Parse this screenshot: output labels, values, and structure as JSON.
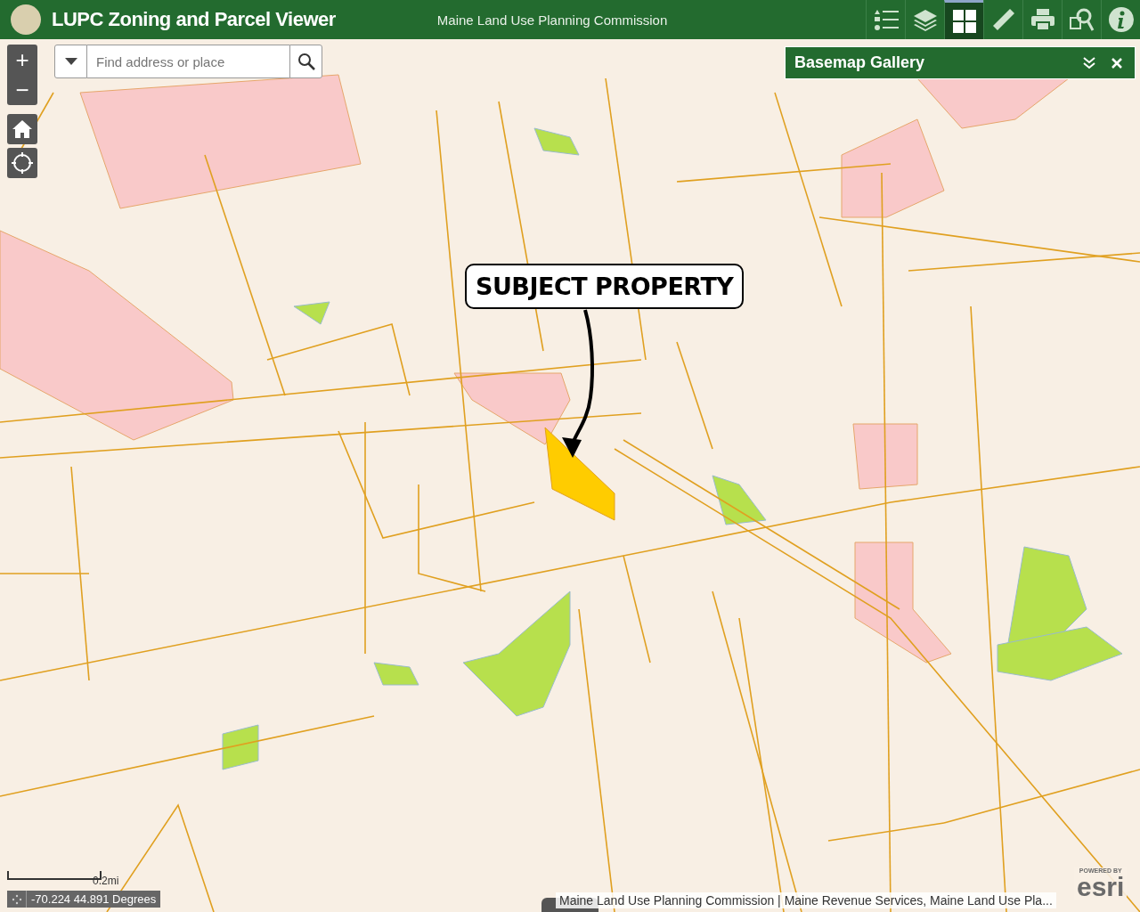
{
  "header": {
    "title": "LUPC Zoning and Parcel Viewer",
    "subtitle": "Maine Land Use Planning Commission",
    "tools": [
      {
        "kind": "legend",
        "selected": false
      },
      {
        "kind": "layers",
        "selected": false
      },
      {
        "kind": "basemap",
        "selected": true
      },
      {
        "kind": "measure",
        "selected": false
      },
      {
        "kind": "print",
        "selected": false
      },
      {
        "kind": "query",
        "selected": false
      },
      {
        "kind": "about",
        "selected": false
      }
    ]
  },
  "zoom_controls": [
    "+",
    "−"
  ],
  "search": {
    "placeholder": "Find address or place"
  },
  "panel": {
    "title": "Basemap Gallery"
  },
  "callout": {
    "text": "SUBJECT PROPERTY"
  },
  "scale": {
    "label": "0.2mi"
  },
  "coordinates": {
    "text": "-70.224 44.891 Degrees"
  },
  "attribution": "Maine Land Use Planning Commission | Maine Revenue Services, Maine Land Use Pla...",
  "logo": {
    "caption": "POWERED BY",
    "name": "esri"
  }
}
